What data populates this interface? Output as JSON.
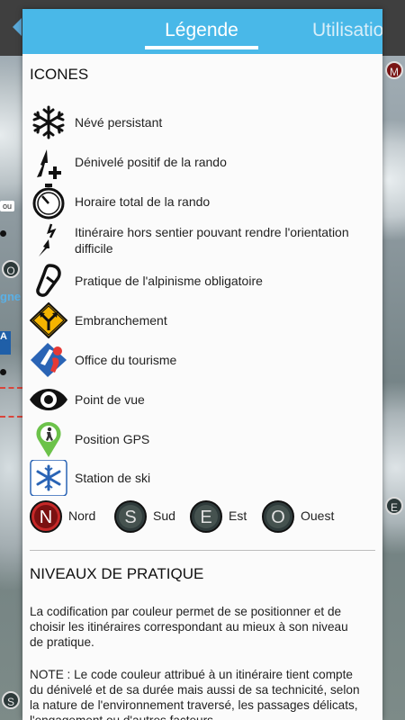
{
  "map": {
    "labels": [
      "ou",
      "gne"
    ],
    "badges": [
      "M",
      "O",
      "S",
      "E"
    ],
    "pills": [
      "ou"
    ],
    "blue_label": "A"
  },
  "tabs": [
    {
      "label": "Légende",
      "active": true
    },
    {
      "label": "Utilisation",
      "active": false
    }
  ],
  "icons_section": {
    "title": "ICONES",
    "items": [
      {
        "icon": "snowflake-icon",
        "label": "Névé persistant"
      },
      {
        "icon": "elevation-gain-icon",
        "label": "Dénivelé positif de la rando"
      },
      {
        "icon": "stopwatch-icon",
        "label": "Horaire total de la rando"
      },
      {
        "icon": "off-trail-icon",
        "label": "Itinéraire hors sentier pouvant rendre l'orientation difficile"
      },
      {
        "icon": "carabiner-icon",
        "label": "Pratique de l'alpinisme obligatoire"
      },
      {
        "icon": "junction-sign-icon",
        "label": "Embranchement"
      },
      {
        "icon": "tourism-office-icon",
        "label": "Office du tourisme"
      },
      {
        "icon": "eye-icon",
        "label": "Point de vue"
      },
      {
        "icon": "gps-position-icon",
        "label": "Position GPS"
      },
      {
        "icon": "ski-station-icon",
        "label": "Station de ski"
      }
    ],
    "directions": [
      {
        "letter": "N",
        "label": "Nord",
        "color": "#c62828"
      },
      {
        "letter": "S",
        "label": "Sud",
        "color": "#2f3b3b"
      },
      {
        "letter": "E",
        "label": "Est",
        "color": "#2f3b3b"
      },
      {
        "letter": "O",
        "label": "Ouest",
        "color": "#2f3b3b"
      }
    ]
  },
  "levels_section": {
    "title": "NIVEAUX DE PRATIQUE",
    "paragraph1": "La codification par couleur permet de se positionner et de choisir les itinéraires correspondant au mieux à son niveau de pratique.",
    "paragraph2": "NOTE : Le code couleur attribué à un itinéraire tient compte du dénivelé et de sa durée mais aussi de sa technicité, selon la nature de l'environnement traversé, les passages délicats, l'engagement ou d'autres facteurs"
  },
  "colors": {
    "tab_bar": "#49b8e8",
    "panel_bg": "#fbfbfb"
  }
}
